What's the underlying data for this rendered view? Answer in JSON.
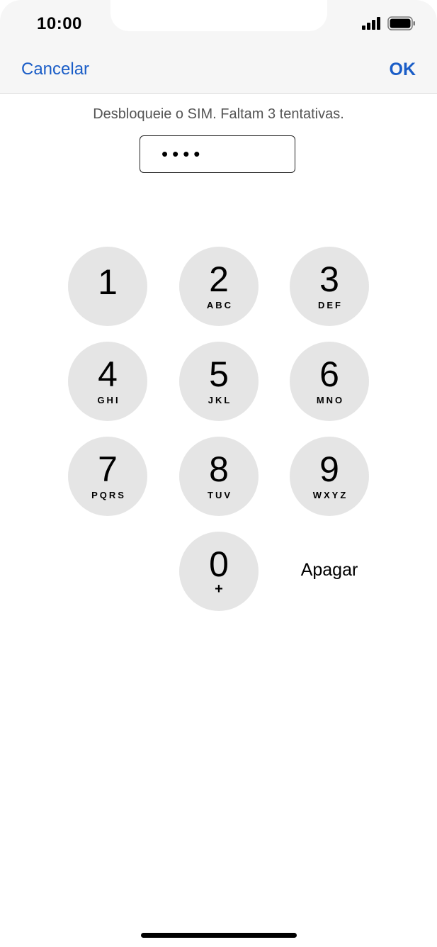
{
  "status_bar": {
    "time": "10:00",
    "signal_icon": "cellular-signal-icon",
    "battery_icon": "battery-full-icon"
  },
  "nav": {
    "cancel_label": "Cancelar",
    "ok_label": "OK"
  },
  "sim_unlock": {
    "prompt": "Desbloqueie o SIM. Faltam 3 tentativas.",
    "pin_masked": "••••"
  },
  "keypad": {
    "keys": [
      {
        "digit": "1",
        "letters": ""
      },
      {
        "digit": "2",
        "letters": "ABC"
      },
      {
        "digit": "3",
        "letters": "DEF"
      },
      {
        "digit": "4",
        "letters": "GHI"
      },
      {
        "digit": "5",
        "letters": "JKL"
      },
      {
        "digit": "6",
        "letters": "MNO"
      },
      {
        "digit": "7",
        "letters": "PQRS"
      },
      {
        "digit": "8",
        "letters": "TUV"
      },
      {
        "digit": "9",
        "letters": "WXYZ"
      },
      {
        "digit": "0",
        "letters": "+"
      }
    ],
    "delete_label": "Apagar"
  },
  "colors": {
    "accent": "#1a5dc7",
    "key_background": "#e5e5e5",
    "nav_background": "#f6f6f6"
  }
}
